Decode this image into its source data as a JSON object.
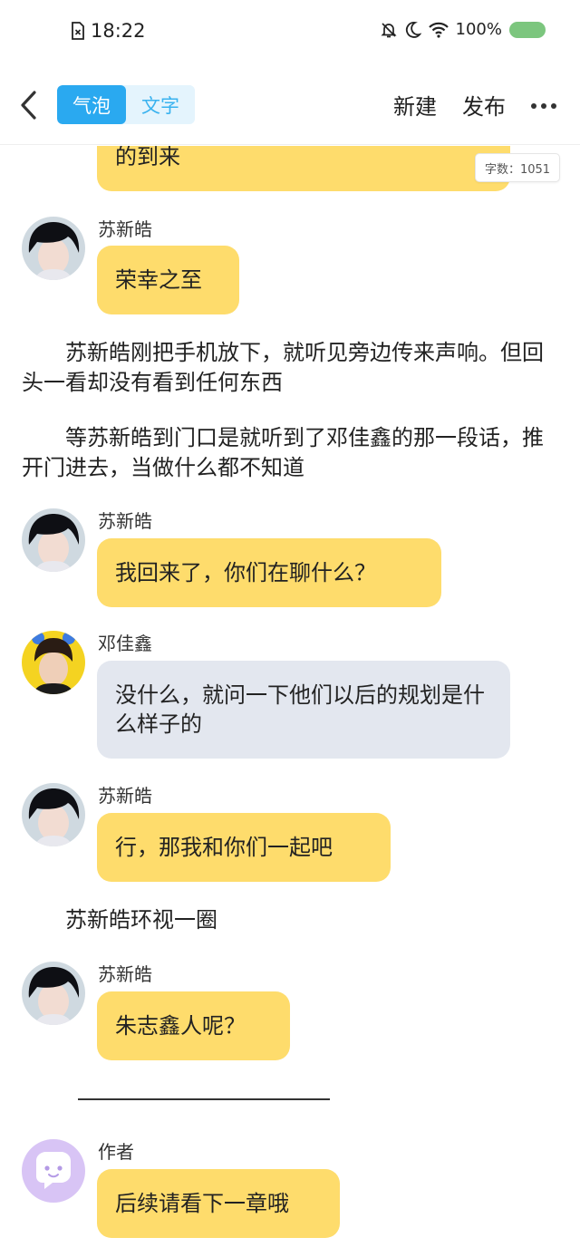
{
  "status_bar": {
    "time": "18:22",
    "battery_text": "100%",
    "icons": [
      "sim-missing-icon",
      "notifications-off-icon",
      "do-not-disturb-icon",
      "wifi-icon",
      "battery-icon"
    ]
  },
  "nav": {
    "tabs": [
      {
        "label": "气泡",
        "active": true
      },
      {
        "label": "文字",
        "active": false
      }
    ],
    "new_label": "新建",
    "publish_label": "发布"
  },
  "word_count": "字数：1051",
  "messages": [
    {
      "type": "bubble-partial",
      "text": "的到来"
    },
    {
      "type": "chat",
      "sender": "苏新皓",
      "text": "荣幸之至",
      "style": "yellow"
    },
    {
      "type": "narration",
      "text": "苏新皓刚把手机放下，就听见旁边传来声响。但回头一看却没有看到任何东西"
    },
    {
      "type": "narration",
      "text": "等苏新皓到门口是就听到了邓佳鑫的那一段话，推开门进去，当做什么都不知道"
    },
    {
      "type": "chat",
      "sender": "苏新皓",
      "text": "我回来了，你们在聊什么？",
      "style": "yellow"
    },
    {
      "type": "chat",
      "sender": "邓佳鑫",
      "text": "没什么，就问一下他们以后的规划是什么样子的",
      "style": "gray"
    },
    {
      "type": "chat",
      "sender": "苏新皓",
      "text": "行，那我和你们一起吧",
      "style": "yellow"
    },
    {
      "type": "narration",
      "text": "苏新皓环视一圈"
    },
    {
      "type": "chat",
      "sender": "苏新皓",
      "text": "朱志鑫人呢？",
      "style": "yellow"
    },
    {
      "type": "chat",
      "sender": "作者",
      "text": "后续请看下一章哦",
      "style": "yellow"
    }
  ],
  "colors": {
    "accent": "#2aa9f0",
    "bubble_yellow": "#fedc6c",
    "bubble_gray": "#e3e7ef",
    "author_avatar": "#d8c4f5"
  }
}
